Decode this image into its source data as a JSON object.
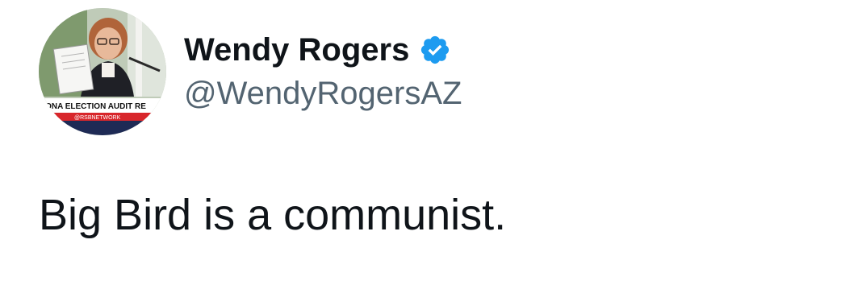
{
  "author": {
    "display_name": "Wendy Rogers",
    "handle": "@WendyRogersAZ",
    "verified_icon": "verified-badge-icon",
    "avatar": {
      "banner_text": "ZONA ELECTION AUDIT RE",
      "banner_sub": "@RSBNETWORK"
    }
  },
  "tweet": {
    "text": "Big Bird is a communist."
  },
  "colors": {
    "verified": "#1d9bf0",
    "text": "#0f1419",
    "handle": "#536471"
  }
}
